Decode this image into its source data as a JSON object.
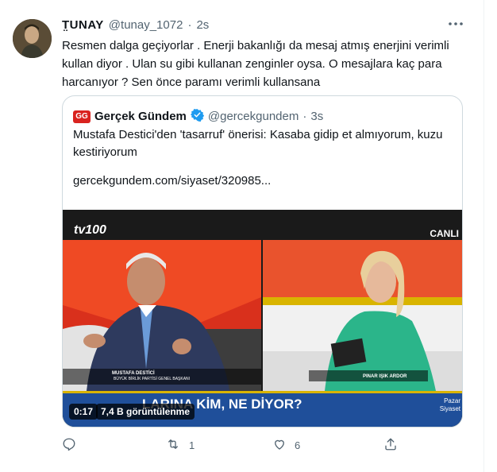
{
  "tweet": {
    "display_name": "T̤UNAY",
    "handle": "@tunay_1072",
    "separator": "·",
    "time": "2s",
    "text": "Resmen dalga geçiyorlar . Enerji bakanlığı da mesaj atmış enerjini verimli kullan diyor . Ulan su gibi kullanan zenginler oysa. O mesajlara kaç para harcanıyor ? Sen önce paramı verimli kullansana",
    "more_icon": "ellipsis-icon"
  },
  "quote": {
    "logo_text": "GG",
    "display_name": "Gerçek Gündem",
    "verified_icon": "verified-badge-icon",
    "handle": "@gercekgundem",
    "separator": "·",
    "time": "3s",
    "text": "Mustafa Destici'den 'tasarruf' önerisi: Kasaba gidip et almıyorum, kuzu kestiriyorum",
    "link": "gercekgundem.com/siyaset/320985..."
  },
  "video": {
    "channel": "tv100",
    "live_label": "CANLI",
    "lower_third": "LARINA KİM, NE DİYOR?",
    "program": [
      "Pazar",
      "Siyaset"
    ],
    "caption_left_name": "MUSTAFA DESTİCİ",
    "caption_left_title": "BÜYÜK BİRLİK PARTİSİ GENEL BAŞKANI",
    "caption_right_name": "PINAR IŞIK ARDOR",
    "duration": "0:17",
    "views": "7,4 B görüntülenme"
  },
  "actions": {
    "reply_count": "",
    "retweet_count": "1",
    "like_count": "6",
    "share_count": ""
  },
  "colors": {
    "accent": "#1d9bf0",
    "muted": "#536471",
    "border": "#cfd9de"
  }
}
